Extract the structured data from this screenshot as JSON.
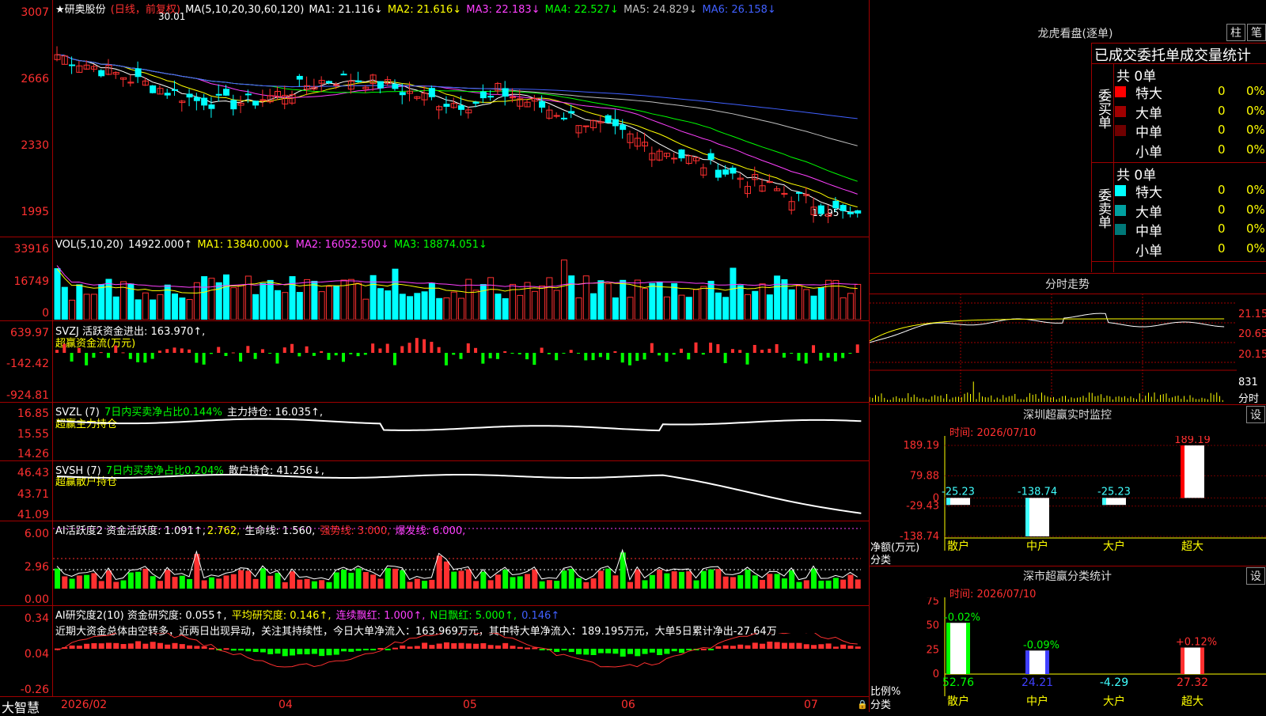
{
  "header": {
    "stock_name": "★研奥股份",
    "period": "(日线，前复权)",
    "ma_label": "MA(5,10,20,30,60,120)",
    "ma": [
      {
        "label": "MA1: 21.116↓",
        "color": "#ffffff"
      },
      {
        "label": "MA2: 21.616↓",
        "color": "#ffff00"
      },
      {
        "label": "MA3: 22.183↓",
        "color": "#ff40ff"
      },
      {
        "label": "MA4: 22.527↓",
        "color": "#00ff00"
      },
      {
        "label": "MA5: 24.829↓",
        "color": "#c0c0c0"
      },
      {
        "label": "MA6: 26.158↓",
        "color": "#4060ff"
      }
    ],
    "high_mark": "30.01",
    "low_mark": "19.95"
  },
  "price_axis": [
    "3007",
    "2666",
    "2330",
    "1995"
  ],
  "vol": {
    "title": "VOL(5,10,20)",
    "value": "14922.000↑",
    "ma": [
      {
        "label": "MA1: 13840.000↓",
        "color": "#ffff00"
      },
      {
        "label": "MA2: 16052.500↓",
        "color": "#ff40ff"
      },
      {
        "label": "MA3: 18874.051↓",
        "color": "#00ff00"
      }
    ],
    "axis": [
      "33916",
      "16749",
      "0"
    ]
  },
  "svzj": {
    "title": "SVZJ  活跃资金进出: 163.970↑,",
    "subtitle": "超赢资金流(万元)",
    "axis": [
      "639.97",
      "-142.42",
      "-924.81"
    ]
  },
  "svzl": {
    "prefix": "SVZL (7) ",
    "part1": "7日内买卖净占比0.144%",
    "part2": " 主力持仓: 16.035↑,",
    "subtitle": "超赢主力持仓",
    "axis": [
      "16.85",
      "15.55",
      "14.26"
    ]
  },
  "svsh": {
    "prefix": "SVSH (7) ",
    "part1": "7日内买卖净占比0.204%",
    "part2": " 散户持仓: 41.256↓,",
    "subtitle": "超赢散户持仓",
    "axis": [
      "46.43",
      "43.71",
      "41.09"
    ]
  },
  "ai1": {
    "prefix": "AI活跃度2 资金活跃度: 1.091↑,",
    "p2": "2.762,",
    "p3": " 生命线: 1.560,",
    "p4": " 强势线: 3.000,",
    "p5": " 爆发线: 6.000,",
    "axis": [
      "6.00",
      "2.96",
      "0.00"
    ]
  },
  "ai2": {
    "prefix": "AI研究度2(10) 资金研究度: 0.055↑,",
    "p2": " 平均研究度: 0.146↑,",
    "p3": " 连续飘红: 1.000↑,",
    "p4": " N日飘红: 5.000↑,",
    "p5": " 0.146↑",
    "note": "近期大资金总体由空转多，近两日出现异动，关注其持续性，今日大单净流入：163.969万元，其中特大单净流入：189.195万元，大单5日累计净出-27.64万",
    "axis": [
      "0.34",
      "0.04",
      "-0.26"
    ]
  },
  "x_axis": [
    "2026/02",
    "04",
    "05",
    "06",
    "07"
  ],
  "footer": {
    "brand": "大智慧"
  },
  "right": {
    "lhb": {
      "title": "龙虎看盘(逐单)",
      "btn1": "柱",
      "btn2": "笔",
      "header": "已成交委托单成交量统计",
      "buy_label": "委买单",
      "sell_label": "委卖单",
      "buy_total": "共 0单",
      "sell_total": "共 0单",
      "buy_rows": [
        {
          "name": "特大",
          "v": "0",
          "p": "0%",
          "color": "#ff0000"
        },
        {
          "name": "大单",
          "v": "0",
          "p": "0%",
          "color": "#a00000"
        },
        {
          "name": "中单",
          "v": "0",
          "p": "0%",
          "color": "#700000"
        },
        {
          "name": "小单",
          "v": "0",
          "p": "0%",
          "color": ""
        }
      ],
      "sell_rows": [
        {
          "name": "特大",
          "v": "0",
          "p": "0%",
          "color": "#00ffff"
        },
        {
          "name": "大单",
          "v": "0",
          "p": "0%",
          "color": "#00a0a0"
        },
        {
          "name": "中单",
          "v": "0",
          "p": "0%",
          "color": "#007878"
        },
        {
          "name": "小单",
          "v": "0",
          "p": "0%",
          "color": ""
        }
      ]
    },
    "fenshi": {
      "title": "分时走势",
      "axis": [
        "21.15",
        "20.65",
        "20.15"
      ],
      "vol_label": "831",
      "vol_unit": "分时"
    },
    "monitor": {
      "title": "深圳超赢实时监控",
      "set": "设",
      "time": "时间: 2026/07/10",
      "axis": [
        "189.19",
        "79.88",
        "0",
        "-29.43",
        "-138.74"
      ],
      "ylabel": "净额(万元)",
      "xlabel": "分类"
    },
    "classify": {
      "title": "深市超赢分类统计",
      "set": "设",
      "time": "时间: 2026/07/10",
      "axis": [
        "75",
        "50",
        "25",
        "0"
      ],
      "ylabel": "比例%",
      "xlabel": "分类"
    }
  },
  "chart_data": [
    {
      "type": "bar",
      "title": "深圳超赢实时监控",
      "categories": [
        "散户",
        "中户",
        "大户",
        "超大"
      ],
      "values": [
        -25.23,
        -138.74,
        -25.23,
        189.19
      ],
      "ylim": [
        -138.74,
        189.19
      ]
    },
    {
      "type": "bar",
      "title": "深市超赢分类统计",
      "categories": [
        "散户",
        "中户",
        "大户",
        "超大"
      ],
      "values": [
        52.76,
        24.21,
        -4.29,
        27.32
      ],
      "changes": [
        "-0.02%",
        "-0.09%",
        "",
        "+0.12%"
      ],
      "ylim": [
        0,
        75
      ]
    }
  ]
}
